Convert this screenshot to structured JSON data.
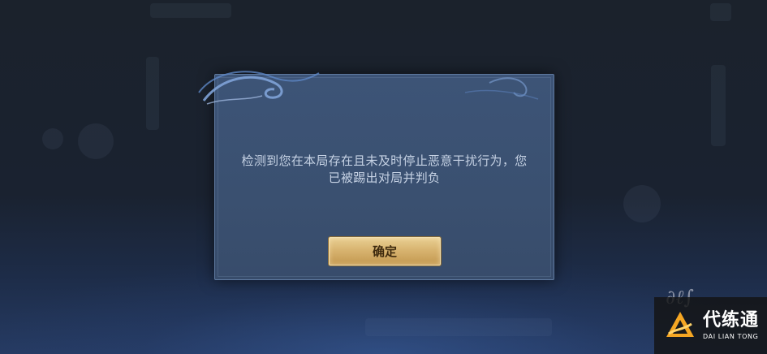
{
  "dialog": {
    "message_line1": "检测到您在本局存在且未及时停止恶意干扰行为，您",
    "message_line2": "已被踢出对局并判负",
    "confirm_label": "确定"
  },
  "watermark": {
    "brand_cn": "代练通",
    "brand_en": "DAI LIAN TONG"
  },
  "colors": {
    "dialog_bg": "#3d5477",
    "button_gold": "#d8b470",
    "text": "#c6d2e4"
  }
}
